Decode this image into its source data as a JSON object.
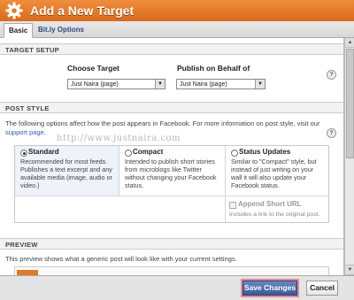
{
  "dialog": {
    "title": "Add a New Target",
    "tabs": [
      "Basic",
      "Bit.ly Options"
    ]
  },
  "target_setup": {
    "heading": "TARGET SETUP",
    "choose_target_label": "Choose Target",
    "choose_target_value": "Just Naira (page)",
    "publish_label": "Publish on Behalf of",
    "publish_value": "Just Naira (page)",
    "help": "?"
  },
  "post_style": {
    "heading": "POST STYLE",
    "description": "The following options affect how the post appears in Facebook. For more information on post style, visit our",
    "support_link": "support page",
    "link_suffix": ".",
    "watermark": "http://www.justnaira.com",
    "help": "?",
    "options": [
      {
        "title": "Standard",
        "desc": "Recommended for most feeds. Publishes a text excerpt and any available media (image, audio or video.)",
        "selected": true
      },
      {
        "title": "Compact",
        "desc": "Intended to publish short stories from microblogs like Twitter without changing your Facebook status.",
        "selected": false
      },
      {
        "title": "Status Updates",
        "desc": "Similar to \"Compact\" style, but instead of just writing on your wall it will also update your Facebook status.",
        "selected": false
      }
    ],
    "append_short_url": {
      "title": "Append Short URL",
      "desc": "Includes a link to the original post."
    }
  },
  "preview": {
    "heading": "PREVIEW",
    "description": "This preview shows what a generic post will look like with your current settings."
  },
  "footer": {
    "save_label": "Save Changes",
    "cancel_label": "Cancel"
  },
  "colors": {
    "titlebar": "#e07a2a",
    "save_button": "#3b5998"
  }
}
